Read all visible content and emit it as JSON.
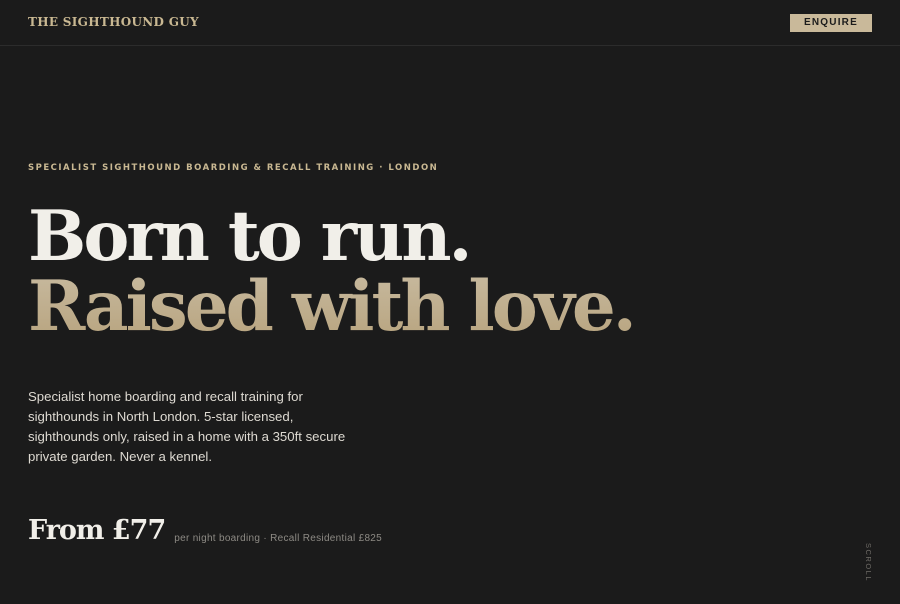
{
  "nav": {
    "brand": "THE SIGHTHOUND GUY",
    "cta_label": "ENQUIRE"
  },
  "hero": {
    "eyebrow": "SPECIALIST SIGHTHOUND BOARDING & RECALL TRAINING · LONDON",
    "headline_line1": "Born to run.",
    "headline_line2": "Raised with love.",
    "lede": "Specialist home boarding and recall training for sighthounds in North London. 5-star licensed, sighthounds only, raised in a home with a 350ft secure private garden. Never a kennel.",
    "price": "From £77",
    "price_note": "per night boarding · Recall Residential £825",
    "scroll_label": "SCROLL"
  },
  "colors": {
    "background": "#1b1b1b",
    "accent": "#c9b99a",
    "headline_light": "#f1efe9"
  }
}
